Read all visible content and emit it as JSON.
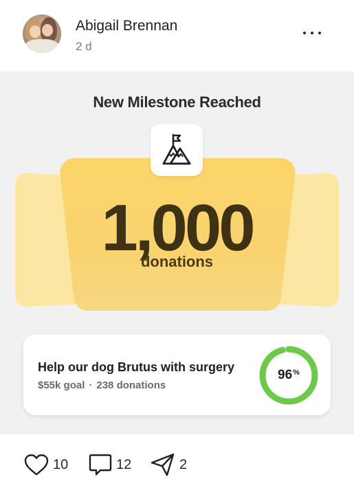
{
  "post": {
    "author": "Abigail Brennan",
    "time": "2 d"
  },
  "milestone": {
    "title": "New Milestone Reached",
    "count": "1,000",
    "unit": "donations",
    "icon": "mountain-flag-icon",
    "card_color": "#fcd56a",
    "side_card_color": "#fbe6a2"
  },
  "fundraiser": {
    "title": "Help our dog Brutus with surgery",
    "goal": "$55k goal",
    "separator": "·",
    "donations": "238 donations",
    "progress_label": "96",
    "progress_unit": "%",
    "progress_fraction": 0.96,
    "ring_color": "#6cc94a",
    "ring_track_color": "#e6e6e6"
  },
  "actions": {
    "likes": "10",
    "comments": "12",
    "shares": "2"
  }
}
